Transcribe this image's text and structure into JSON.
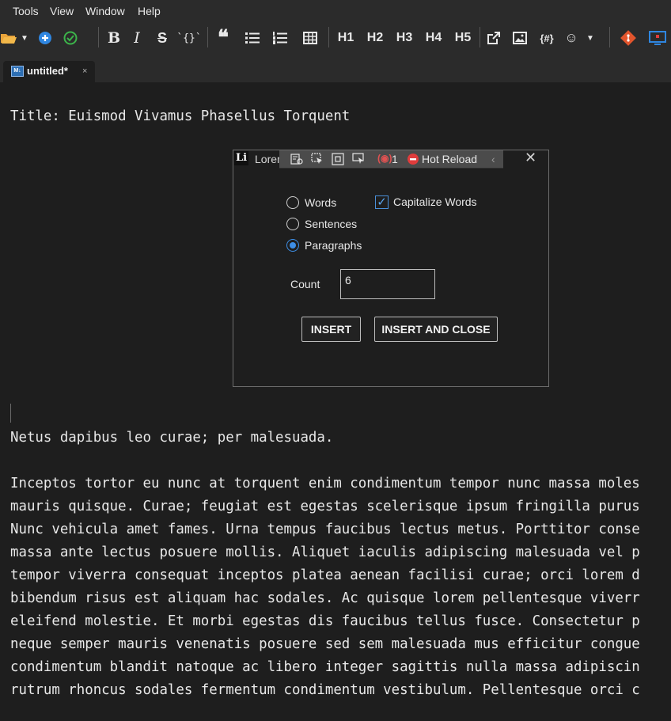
{
  "menu": {
    "items": [
      "Tools",
      "View",
      "Window",
      "Help"
    ]
  },
  "toolbar": {
    "code_label": "`{}`",
    "headings": [
      "H1",
      "H2",
      "H3",
      "H4",
      "H5"
    ],
    "snippet_label": "{#}"
  },
  "tab": {
    "title": "untitled*",
    "close": "×",
    "icon_text": "M↓"
  },
  "editor": {
    "title_line": "Title: Euismod Vivamus Phasellus Torquent",
    "line1": "Netus dapibus leo curae; per malesuada.",
    "paragraph": [
      "Inceptos tortor eu nunc at torquent enim condimentum tempor nunc massa moles",
      "mauris quisque. Curae; feugiat est egestas scelerisque ipsum fringilla purus",
      "Nunc vehicula amet fames. Urna tempus faucibus lectus metus. Porttitor conse",
      "massa ante lectus posuere mollis. Aliquet iaculis adipiscing malesuada vel p",
      "tempor viverra consequat inceptos platea aenean facilisi curae; orci lorem d",
      "bibendum risus est aliquam hac sodales. Ac quisque lorem pellentesque viverr",
      "eleifend molestie. Et morbi egestas dis faucibus tellus fusce. Consectetur p",
      "neque semper mauris venenatis posuere sed sem malesuada mus efficitur congue",
      "condimentum blandit natoque ac libero integer sagittis nulla massa adipiscin",
      "rutrum rhoncus sodales fermentum condimentum vestibulum. Pellentesque orci c"
    ]
  },
  "dialog": {
    "icon_text": "Li",
    "title": "Lorem",
    "hot_reload_count": "1",
    "hot_reload_label": "Hot Reload",
    "close": "✕",
    "options": {
      "words": "Words",
      "sentences": "Sentences",
      "paragraphs": "Paragraphs",
      "selected": "Paragraphs"
    },
    "capitalize_label": "Capitalize Words",
    "capitalize_checked": true,
    "count_label": "Count",
    "count_value": "6",
    "insert_label": "INSERT",
    "insert_close_label": "INSERT AND CLOSE"
  }
}
